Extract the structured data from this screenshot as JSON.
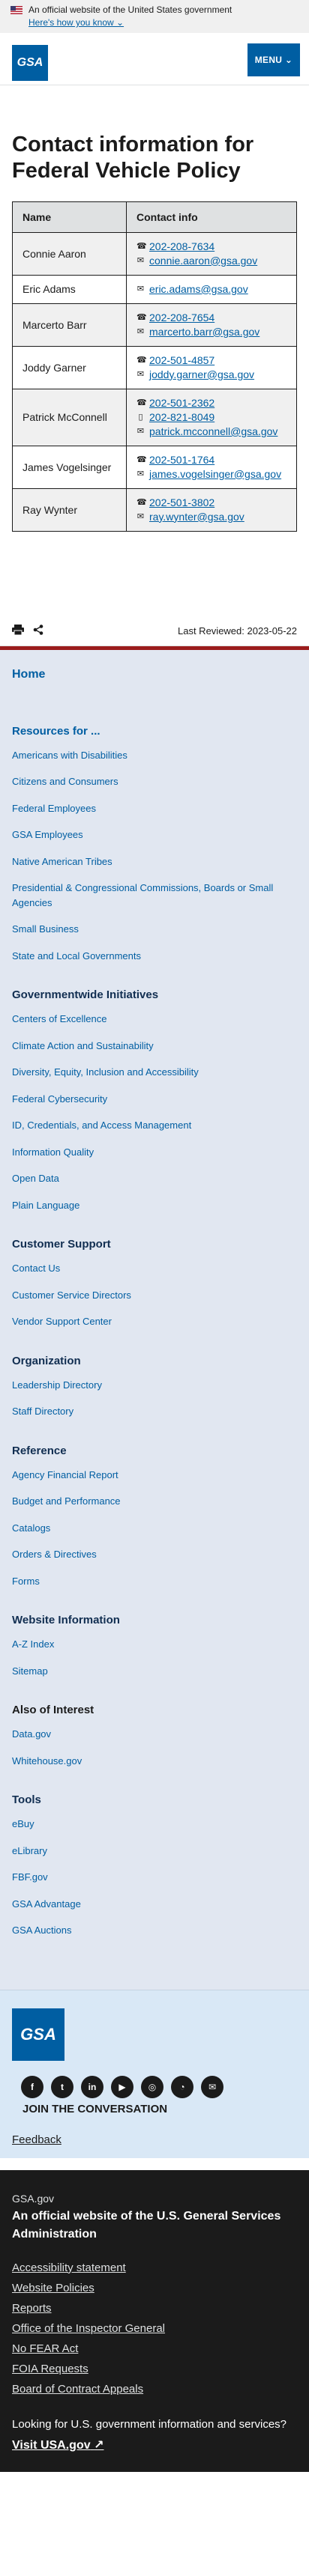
{
  "banner": {
    "official_text": "An official website of the United States government",
    "know_link": "Here's how you know ⌄"
  },
  "header": {
    "logo_text": "GSA",
    "menu_label": "MENU ⌄"
  },
  "page": {
    "title": "Contact information for Federal Vehicle Policy"
  },
  "table": {
    "headers": [
      "Name",
      "Contact info"
    ],
    "rows": [
      {
        "name": "Connie Aaron",
        "lines": [
          {
            "icon": "phone-icon",
            "text": "202-208-7634"
          },
          {
            "icon": "email-icon",
            "text": "connie.aaron@gsa.gov"
          }
        ]
      },
      {
        "name": "Eric Adams",
        "lines": [
          {
            "icon": "email-icon",
            "text": "eric.adams@gsa.gov"
          }
        ]
      },
      {
        "name": "Marcerto Barr",
        "lines": [
          {
            "icon": "phone-icon",
            "text": "202-208-7654"
          },
          {
            "icon": "email-icon",
            "text": "marcerto.barr@gsa.gov"
          }
        ]
      },
      {
        "name": "Joddy Garner",
        "lines": [
          {
            "icon": "phone-icon",
            "text": "202-501-4857"
          },
          {
            "icon": "email-icon",
            "text": "joddy.garner@gsa.gov"
          }
        ]
      },
      {
        "name": "Patrick McConnell",
        "lines": [
          {
            "icon": "phone-icon",
            "text": "202-501-2362"
          },
          {
            "icon": "mobile-icon",
            "text": "202-821-8049"
          },
          {
            "icon": "email-icon",
            "text": "patrick.mcconnell@gsa.gov"
          }
        ]
      },
      {
        "name": "James Vogelsinger",
        "lines": [
          {
            "icon": "phone-icon",
            "text": "202-501-1764"
          },
          {
            "icon": "email-icon",
            "text": "james.vogelsinger@gsa.gov"
          }
        ]
      },
      {
        "name": "Ray Wynter",
        "lines": [
          {
            "icon": "phone-icon",
            "text": "202-501-3802"
          },
          {
            "icon": "email-icon",
            "text": "ray.wynter@gsa.gov"
          }
        ]
      }
    ]
  },
  "utility": {
    "reviewed": "Last Reviewed: 2023-05-22"
  },
  "nav": {
    "home": "Home",
    "sections": [
      {
        "heading": "Resources for ...",
        "style": "blue",
        "items": [
          "Americans with Disabilities",
          "Citizens and Consumers",
          "Federal Employees",
          "GSA Employees",
          "Native American Tribes",
          "Presidential & Congressional Commissions, Boards or Small Agencies",
          "Small Business",
          "State and Local Governments"
        ]
      },
      {
        "heading": "Governmentwide Initiatives",
        "style": "dark",
        "items": [
          "Centers of Excellence",
          "Climate Action and Sustainability",
          "Diversity, Equity, Inclusion and Accessibility",
          "Federal Cybersecurity",
          "ID, Credentials, and Access Management",
          "Information Quality",
          "Open Data",
          "Plain Language"
        ]
      },
      {
        "heading": "Customer Support",
        "style": "dark",
        "items": [
          "Contact Us",
          "Customer Service Directors",
          "Vendor Support Center"
        ]
      },
      {
        "heading": "Organization",
        "style": "dark",
        "items": [
          "Leadership Directory",
          "Staff Directory"
        ]
      },
      {
        "heading": "Reference",
        "style": "dark",
        "items": [
          "Agency Financial Report",
          "Budget and Performance",
          "Catalogs",
          "Orders & Directives",
          "Forms"
        ]
      },
      {
        "heading": "Website Information",
        "style": "dark",
        "items": [
          "A-Z Index",
          "Sitemap"
        ]
      },
      {
        "heading": "Also of Interest",
        "style": "black",
        "items": [
          "Data.gov",
          "Whitehouse.gov"
        ]
      },
      {
        "heading": "Tools",
        "style": "dark",
        "items": [
          "eBuy",
          "eLibrary",
          "FBF.gov",
          "GSA Advantage",
          "GSA Auctions"
        ]
      }
    ]
  },
  "social": {
    "logo_text": "GSA",
    "icons": [
      "facebook-icon",
      "twitter-icon",
      "linkedin-icon",
      "youtube-icon",
      "instagram-icon",
      "rss-icon",
      "email-icon"
    ],
    "join_label": "JOIN THE CONVERSATION",
    "feedback_label": "Feedback"
  },
  "identifier": {
    "domain": "GSA.gov",
    "official": "An official website of the U.S. General Services Administration",
    "links": [
      "Accessibility statement",
      "Website Policies",
      "Reports",
      "Office of the Inspector General",
      "No FEAR Act",
      "FOIA Requests",
      "Board of Contract Appeals"
    ],
    "lookup": "Looking for U.S. government information and services?",
    "visit": "Visit USA.gov"
  }
}
